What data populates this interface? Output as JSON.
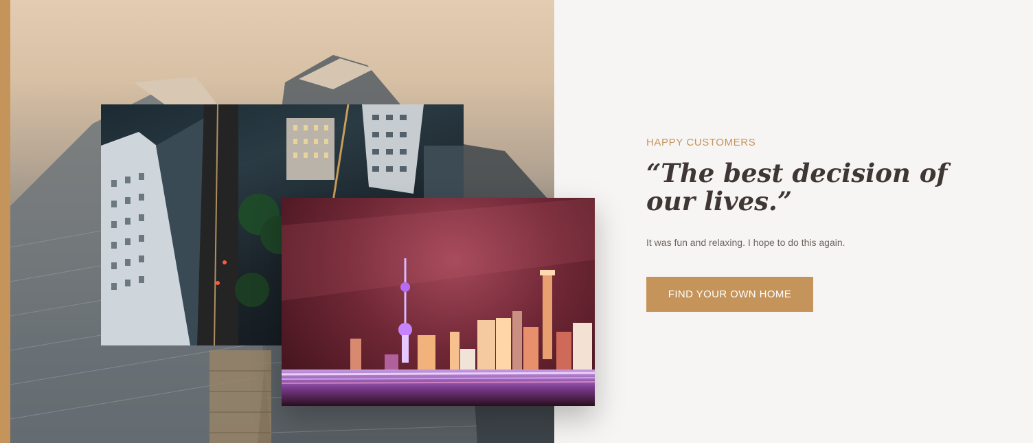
{
  "colors": {
    "accent": "#c4945a",
    "heading": "#3f3733",
    "body_text": "#6b6561",
    "background": "#f7f5f3"
  },
  "images": {
    "background": "aerial view of skyscrapers in hazy sky",
    "left": "night aerial view of city street between tall buildings",
    "right": "neon city skyline at night with TV tower and light trails"
  },
  "testimonial": {
    "eyebrow": "HAPPY CUSTOMERS",
    "quote": "“The best decision of our lives.”",
    "text": "It was fun and relaxing. I hope to do this again."
  },
  "cta": {
    "label": "FIND YOUR OWN HOME"
  }
}
